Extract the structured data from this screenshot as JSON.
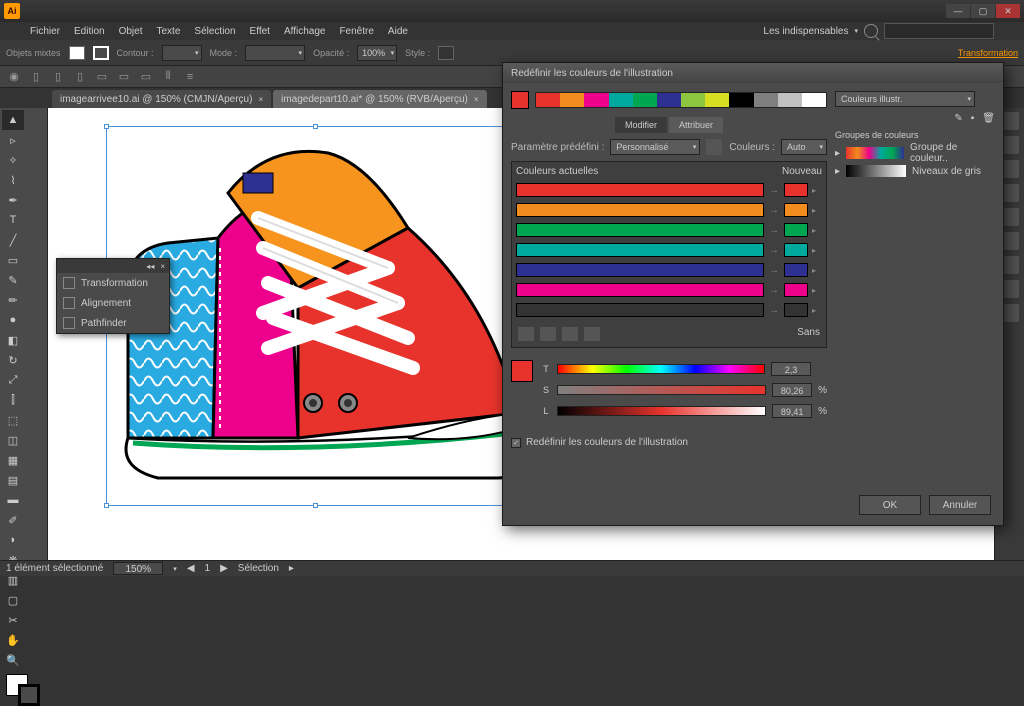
{
  "app": {
    "logo": "Ai"
  },
  "menu": [
    "Fichier",
    "Edition",
    "Objet",
    "Texte",
    "Sélection",
    "Effet",
    "Affichage",
    "Fenêtre",
    "Aide"
  ],
  "doc_controls": {
    "workspace": "Les indispensables"
  },
  "controlbar": {
    "objects": "Objets mixtes",
    "contour": "Contour :",
    "mode": "Mode :",
    "opacity_label": "Opacité :",
    "opacity": "100%",
    "style": "Style :",
    "transform": "Transformation"
  },
  "tabs": [
    {
      "label": "imagearrivee10.ai @ 150% (CMJN/Aperçu)",
      "active": false
    },
    {
      "label": "imagedepart10.ai* @ 150% (RVB/Aperçu)",
      "active": true
    }
  ],
  "float_panel": {
    "items": [
      "Transformation",
      "Alignement",
      "Pathfinder"
    ]
  },
  "dialog": {
    "title": "Redéfinir les couleurs de l'illustration",
    "strip_colors": [
      "#e8332c",
      "#f28c1e",
      "#ec008c",
      "#00a99d",
      "#00a651",
      "#2e3192",
      "#8cc63f",
      "#d7df23",
      "#000000",
      "#808080",
      "#c0c0c0",
      "#ffffff"
    ],
    "lib_dropdown": "Couleurs illustr.",
    "tabs": {
      "modify": "Modifier",
      "assign": "Attribuer"
    },
    "preset_label": "Paramètre prédéfini :",
    "preset_value": "Personnalisé",
    "colors_label": "Couleurs :",
    "colors_value": "Auto",
    "current": "Couleurs actuelles",
    "new": "Nouveau",
    "rows": [
      {
        "cur": "#e8332c",
        "new": "#e8332c"
      },
      {
        "cur": "#f28c1e",
        "new": "#f28c1e"
      },
      {
        "cur": "#00a651",
        "new": "#00a651"
      },
      {
        "cur": "#00a99d",
        "new": "#00a99d"
      },
      {
        "cur": "#2e3192",
        "new": "#2e3192"
      },
      {
        "cur": "#ec008c",
        "new": "#ec008c"
      },
      {
        "cur": "#333333",
        "new": "#333333"
      }
    ],
    "sans": "Sans",
    "tsl": {
      "T": "2,3",
      "S": "80,26",
      "L": "89,41",
      "pct": "%"
    },
    "checkbox": "Redéfinir les couleurs de l'illustration",
    "groups_head": "Groupes de couleurs",
    "groups": [
      {
        "label": "Groupe de couleur..",
        "ramp": "linear-gradient(90deg,#e8332c,#f28c1e,#ec008c,#00a99d,#00a651,#2e3192)"
      },
      {
        "label": "Niveaux de gris",
        "ramp": "linear-gradient(90deg,#000,#fff)"
      }
    ],
    "ok": "OK",
    "cancel": "Annuler"
  },
  "status": {
    "zoom": "150%",
    "selection": "Sélection",
    "info": "1 élément sélectionné"
  }
}
